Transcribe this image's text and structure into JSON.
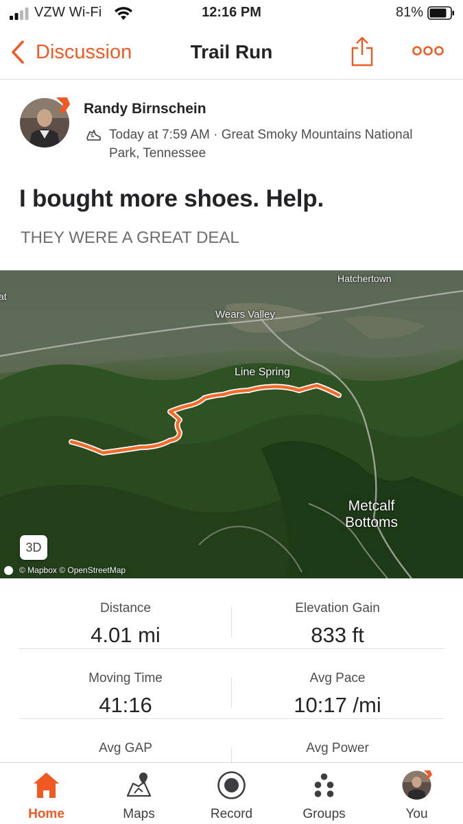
{
  "status_bar": {
    "carrier": "VZW Wi-Fi",
    "time": "12:16 PM",
    "battery": "81%"
  },
  "nav": {
    "back_label": "Discussion",
    "title": "Trail Run"
  },
  "activity": {
    "athlete_name": "Randy Birnschein",
    "meta_line1": "Today at 7:59 AM · Great Smoky Mountains National",
    "meta_line2": "Park, Tennessee",
    "title": "I bought more shoes. Help.",
    "description": "THEY WERE A GREAT DEAL"
  },
  "map": {
    "labels": {
      "hatchertown": "Hatchertown",
      "wears_valley": "Wears Valley",
      "line_spring": "Line Spring",
      "metcalf_1": "Metcalf",
      "metcalf_2": "Bottoms",
      "edge": "at"
    },
    "button_3d": "3D",
    "attribution": "© Mapbox © OpenStreetMap",
    "route_color": "#f26b2a"
  },
  "stats": [
    {
      "label": "Distance",
      "value": "4.01 mi"
    },
    {
      "label": "Elevation Gain",
      "value": "833 ft"
    },
    {
      "label": "Moving Time",
      "value": "41:16"
    },
    {
      "label": "Avg Pace",
      "value": "10:17 /mi"
    },
    {
      "label": "Avg GAP",
      "value": ""
    },
    {
      "label": "Avg Power",
      "value": ""
    }
  ],
  "tabs": [
    {
      "label": "Home",
      "icon": "home-icon",
      "active": true
    },
    {
      "label": "Maps",
      "icon": "maps-icon",
      "active": false
    },
    {
      "label": "Record",
      "icon": "record-icon",
      "active": false
    },
    {
      "label": "Groups",
      "icon": "groups-icon",
      "active": false
    },
    {
      "label": "You",
      "icon": "avatar",
      "active": false
    }
  ],
  "colors": {
    "accent": "#f05a22",
    "text": "#242428",
    "secondary_text": "#4d4d52"
  }
}
